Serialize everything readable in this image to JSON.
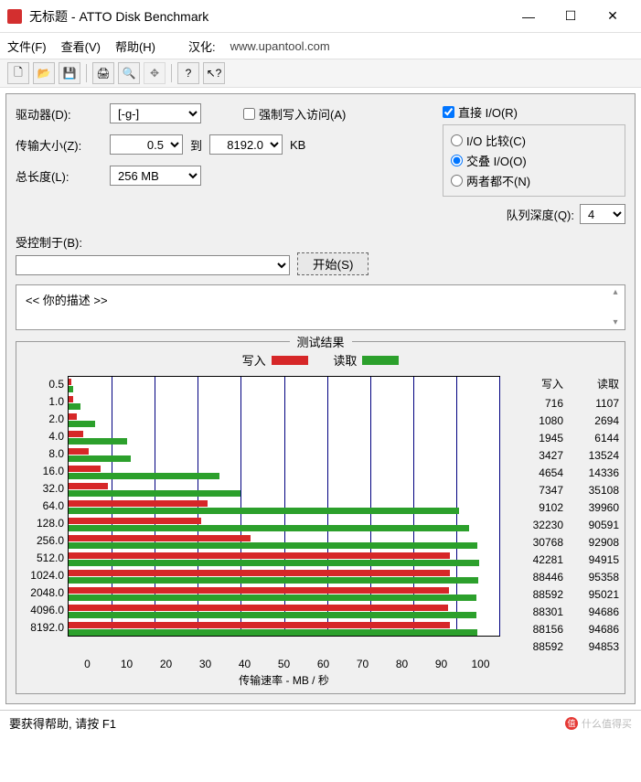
{
  "window": {
    "title": "无标题 - ATTO Disk Benchmark"
  },
  "menu": {
    "file": "文件(F)",
    "view": "查看(V)",
    "help": "帮助(H)",
    "localize": "汉化:",
    "link": "www.upantool.com"
  },
  "labels": {
    "drive": "驱动器(D):",
    "transfer": "传输大小(Z):",
    "to": "到",
    "kb": "KB",
    "length": "总长度(L):",
    "force_write": "强制写入访问(A)",
    "direct_io": "直接 I/O(R)",
    "io_compare": "I/O 比较(C)",
    "overlap_io": "交叠 I/O(O)",
    "neither": "两者都不(N)",
    "queue": "队列深度(Q):",
    "controlled": "受控制于(B):",
    "start": "开始(S)",
    "desc": "<<  你的描述   >>",
    "results": "测试结果",
    "write": "写入",
    "read": "读取",
    "xlabel": "传输速率 - MB / 秒",
    "status": "要获得帮助, 请按 F1",
    "watermark": "什么值得买"
  },
  "values": {
    "drive": "[-g-]",
    "size_from": "0.5",
    "size_to": "8192.0",
    "length": "256 MB",
    "queue": "4"
  },
  "chart_data": {
    "type": "bar",
    "xmax": 100,
    "xticks": [
      0,
      10,
      20,
      30,
      40,
      50,
      60,
      70,
      80,
      90,
      100
    ],
    "categories": [
      "0.5",
      "1.0",
      "2.0",
      "4.0",
      "8.0",
      "16.0",
      "32.0",
      "64.0",
      "128.0",
      "256.0",
      "512.0",
      "1024.0",
      "2048.0",
      "4096.0",
      "8192.0"
    ],
    "series": [
      {
        "name": "写入",
        "color": "#d62728",
        "values": [
          716,
          1080,
          1945,
          3427,
          4654,
          7347,
          9102,
          32230,
          30768,
          42281,
          88446,
          88592,
          88301,
          88156,
          88592
        ]
      },
      {
        "name": "读取",
        "color": "#2ca02c",
        "values": [
          1107,
          2694,
          6144,
          13524,
          14336,
          35108,
          39960,
          90591,
          92908,
          94915,
          95358,
          95021,
          94686,
          94686,
          94853
        ]
      }
    ],
    "display_divisor": 1000
  }
}
